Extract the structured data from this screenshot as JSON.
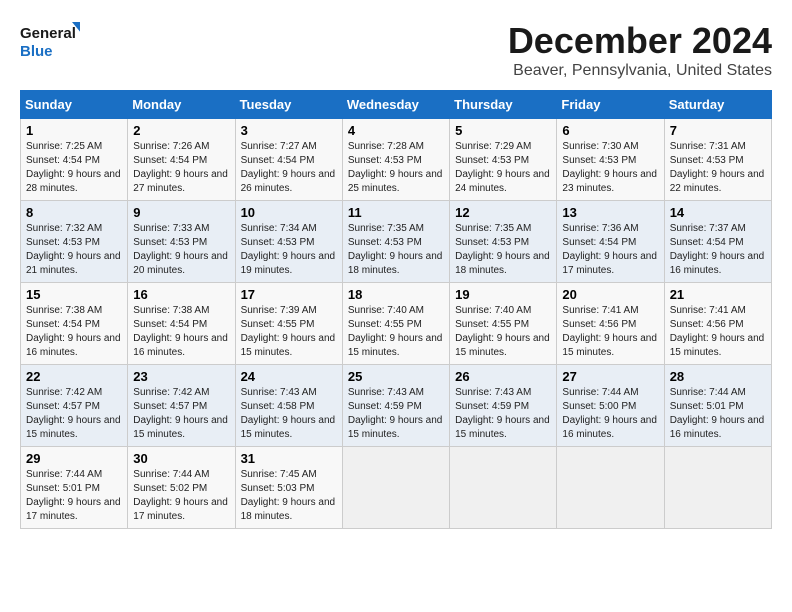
{
  "logo": {
    "line1": "General",
    "line2": "Blue"
  },
  "title": "December 2024",
  "subtitle": "Beaver, Pennsylvania, United States",
  "weekdays": [
    "Sunday",
    "Monday",
    "Tuesday",
    "Wednesday",
    "Thursday",
    "Friday",
    "Saturday"
  ],
  "weeks": [
    [
      {
        "day": "1",
        "sunrise": "7:25 AM",
        "sunset": "4:54 PM",
        "daylight": "9 hours and 28 minutes."
      },
      {
        "day": "2",
        "sunrise": "7:26 AM",
        "sunset": "4:54 PM",
        "daylight": "9 hours and 27 minutes."
      },
      {
        "day": "3",
        "sunrise": "7:27 AM",
        "sunset": "4:54 PM",
        "daylight": "9 hours and 26 minutes."
      },
      {
        "day": "4",
        "sunrise": "7:28 AM",
        "sunset": "4:53 PM",
        "daylight": "9 hours and 25 minutes."
      },
      {
        "day": "5",
        "sunrise": "7:29 AM",
        "sunset": "4:53 PM",
        "daylight": "9 hours and 24 minutes."
      },
      {
        "day": "6",
        "sunrise": "7:30 AM",
        "sunset": "4:53 PM",
        "daylight": "9 hours and 23 minutes."
      },
      {
        "day": "7",
        "sunrise": "7:31 AM",
        "sunset": "4:53 PM",
        "daylight": "9 hours and 22 minutes."
      }
    ],
    [
      {
        "day": "8",
        "sunrise": "7:32 AM",
        "sunset": "4:53 PM",
        "daylight": "9 hours and 21 minutes."
      },
      {
        "day": "9",
        "sunrise": "7:33 AM",
        "sunset": "4:53 PM",
        "daylight": "9 hours and 20 minutes."
      },
      {
        "day": "10",
        "sunrise": "7:34 AM",
        "sunset": "4:53 PM",
        "daylight": "9 hours and 19 minutes."
      },
      {
        "day": "11",
        "sunrise": "7:35 AM",
        "sunset": "4:53 PM",
        "daylight": "9 hours and 18 minutes."
      },
      {
        "day": "12",
        "sunrise": "7:35 AM",
        "sunset": "4:53 PM",
        "daylight": "9 hours and 18 minutes."
      },
      {
        "day": "13",
        "sunrise": "7:36 AM",
        "sunset": "4:54 PM",
        "daylight": "9 hours and 17 minutes."
      },
      {
        "day": "14",
        "sunrise": "7:37 AM",
        "sunset": "4:54 PM",
        "daylight": "9 hours and 16 minutes."
      }
    ],
    [
      {
        "day": "15",
        "sunrise": "7:38 AM",
        "sunset": "4:54 PM",
        "daylight": "9 hours and 16 minutes."
      },
      {
        "day": "16",
        "sunrise": "7:38 AM",
        "sunset": "4:54 PM",
        "daylight": "9 hours and 16 minutes."
      },
      {
        "day": "17",
        "sunrise": "7:39 AM",
        "sunset": "4:55 PM",
        "daylight": "9 hours and 15 minutes."
      },
      {
        "day": "18",
        "sunrise": "7:40 AM",
        "sunset": "4:55 PM",
        "daylight": "9 hours and 15 minutes."
      },
      {
        "day": "19",
        "sunrise": "7:40 AM",
        "sunset": "4:55 PM",
        "daylight": "9 hours and 15 minutes."
      },
      {
        "day": "20",
        "sunrise": "7:41 AM",
        "sunset": "4:56 PM",
        "daylight": "9 hours and 15 minutes."
      },
      {
        "day": "21",
        "sunrise": "7:41 AM",
        "sunset": "4:56 PM",
        "daylight": "9 hours and 15 minutes."
      }
    ],
    [
      {
        "day": "22",
        "sunrise": "7:42 AM",
        "sunset": "4:57 PM",
        "daylight": "9 hours and 15 minutes."
      },
      {
        "day": "23",
        "sunrise": "7:42 AM",
        "sunset": "4:57 PM",
        "daylight": "9 hours and 15 minutes."
      },
      {
        "day": "24",
        "sunrise": "7:43 AM",
        "sunset": "4:58 PM",
        "daylight": "9 hours and 15 minutes."
      },
      {
        "day": "25",
        "sunrise": "7:43 AM",
        "sunset": "4:59 PM",
        "daylight": "9 hours and 15 minutes."
      },
      {
        "day": "26",
        "sunrise": "7:43 AM",
        "sunset": "4:59 PM",
        "daylight": "9 hours and 15 minutes."
      },
      {
        "day": "27",
        "sunrise": "7:44 AM",
        "sunset": "5:00 PM",
        "daylight": "9 hours and 16 minutes."
      },
      {
        "day": "28",
        "sunrise": "7:44 AM",
        "sunset": "5:01 PM",
        "daylight": "9 hours and 16 minutes."
      }
    ],
    [
      {
        "day": "29",
        "sunrise": "7:44 AM",
        "sunset": "5:01 PM",
        "daylight": "9 hours and 17 minutes."
      },
      {
        "day": "30",
        "sunrise": "7:44 AM",
        "sunset": "5:02 PM",
        "daylight": "9 hours and 17 minutes."
      },
      {
        "day": "31",
        "sunrise": "7:45 AM",
        "sunset": "5:03 PM",
        "daylight": "9 hours and 18 minutes."
      },
      null,
      null,
      null,
      null
    ]
  ],
  "labels": {
    "sunrise": "Sunrise: ",
    "sunset": "Sunset: ",
    "daylight": "Daylight: "
  }
}
